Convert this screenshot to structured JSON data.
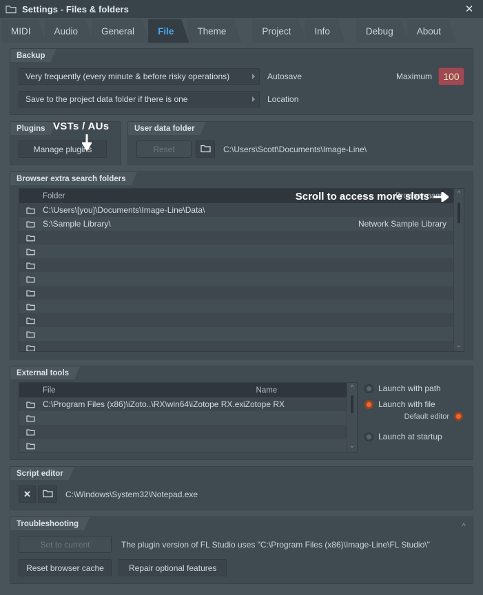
{
  "window": {
    "title": "Settings - Files & folders",
    "icon": "folder-icon",
    "close_label": "✕"
  },
  "tabs": [
    {
      "label": "MIDI",
      "active": false
    },
    {
      "label": "Audio",
      "active": false
    },
    {
      "label": "General",
      "active": false
    },
    {
      "label": "File",
      "active": true
    },
    {
      "label": "Theme",
      "active": false
    },
    {
      "label": "Project",
      "active": false
    },
    {
      "label": "Info",
      "active": false
    },
    {
      "label": "Debug",
      "active": false
    },
    {
      "label": "About",
      "active": false
    }
  ],
  "backup": {
    "title": "Backup",
    "autosave_value": "Very frequently (every minute & before risky operations)",
    "autosave_label": "Autosave",
    "location_value": "Save to the project data folder if there is one",
    "location_label": "Location",
    "maximum_label": "Maximum",
    "maximum_value": "100",
    "maximum_color": "#9d4a54",
    "maximum_text_color": "#f4e6b4"
  },
  "plugins": {
    "title": "Plugins",
    "manage_label": "Manage plugins",
    "annotation": "VSTs / AUs"
  },
  "user_data": {
    "title": "User data folder",
    "reset_label": "Reset",
    "browse_icon": "folder-icon",
    "path": "C:\\Users\\Scott\\Documents\\Image-Line\\"
  },
  "browser_folders": {
    "title": "Browser extra search folders",
    "columns": {
      "folder": "Folder",
      "name": "Browser name"
    },
    "annotation": "Scroll to access more slots",
    "rows": [
      {
        "folder": "C:\\Users\\[you]\\Documents\\Image-Line\\Data\\",
        "name": ""
      },
      {
        "folder": "S:\\Sample Library\\",
        "name": "Network Sample Library"
      },
      {
        "folder": "",
        "name": ""
      },
      {
        "folder": "",
        "name": ""
      },
      {
        "folder": "",
        "name": ""
      },
      {
        "folder": "",
        "name": ""
      },
      {
        "folder": "",
        "name": ""
      },
      {
        "folder": "",
        "name": ""
      },
      {
        "folder": "",
        "name": ""
      },
      {
        "folder": "",
        "name": ""
      },
      {
        "folder": "",
        "name": ""
      },
      {
        "folder": "",
        "name": ""
      }
    ]
  },
  "external_tools": {
    "title": "External tools",
    "columns": {
      "file": "File",
      "name": "Name"
    },
    "rows": [
      {
        "file": "C:\\Program Files (x86)\\iZoto..\\RX\\win64\\iZotope RX.exe",
        "name": "iZotope RX"
      },
      {
        "file": "",
        "name": ""
      },
      {
        "file": "",
        "name": ""
      },
      {
        "file": "",
        "name": ""
      }
    ],
    "options": [
      {
        "label": "Launch with path",
        "selected": false
      },
      {
        "label": "Launch with file",
        "selected": true
      }
    ],
    "default_editor_label": "Default editor",
    "default_editor_selected": true,
    "launch_at_startup": {
      "label": "Launch at startup",
      "selected": false
    }
  },
  "script_editor": {
    "title": "Script editor",
    "clear_label": "✕",
    "browse_icon": "folder-icon",
    "path": "C:\\Windows\\System32\\Notepad.exe"
  },
  "troubleshooting": {
    "title": "Troubleshooting",
    "set_to_current_label": "Set to current",
    "note": "The plugin version of FL Studio uses \"C:\\Program Files (x86)\\Image-Line\\FL Studio\\\"",
    "reset_cache_label": "Reset browser cache",
    "repair_label": "Repair optional features",
    "collapse_icon": "chevron-up-icon"
  }
}
